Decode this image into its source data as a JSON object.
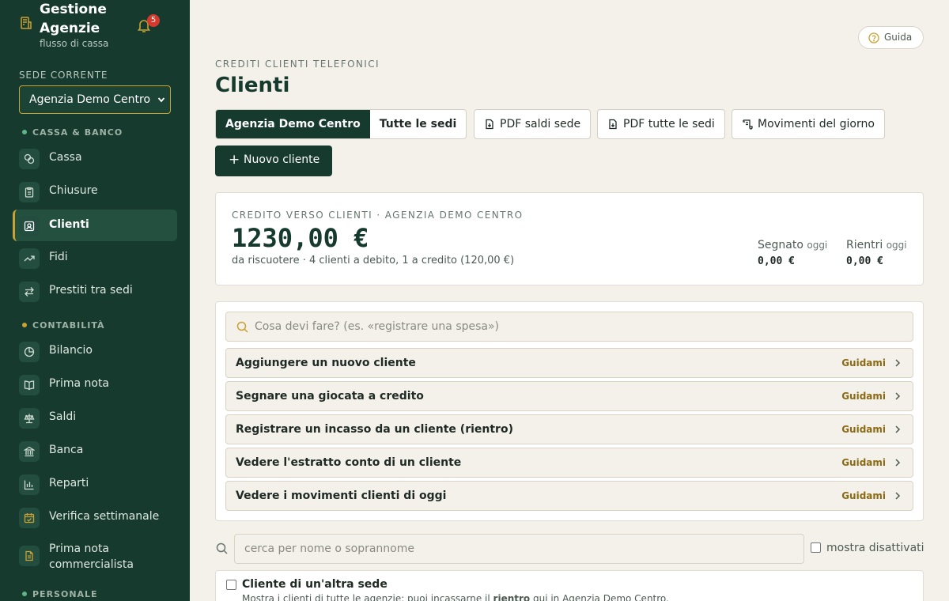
{
  "sidebar": {
    "brand_title": "Gestione Agenzie",
    "brand_subtitle": "flusso di cassa",
    "notification_count": "5",
    "sede_label": "SEDE CORRENTE",
    "sede_value": "Agenzia Demo Centro",
    "sections": [
      {
        "label": "CASSA & BANCO",
        "color": "#5fb58a"
      },
      {
        "label": "CONTABILITÀ",
        "color": "#c9a233"
      },
      {
        "label": "PERSONALE",
        "color": "#5fb58a"
      }
    ],
    "items": [
      {
        "label": "Cassa",
        "icon": "coins-icon"
      },
      {
        "label": "Chiusure",
        "icon": "clipboard-icon"
      },
      {
        "label": "Clienti",
        "icon": "contact-icon",
        "active": true
      },
      {
        "label": "Fidi",
        "icon": "trend-icon"
      },
      {
        "label": "Prestiti tra sedi",
        "icon": "swap-icon"
      },
      {
        "label": "Bilancio",
        "icon": "pie-chart-icon"
      },
      {
        "label": "Prima nota",
        "icon": "book-icon"
      },
      {
        "label": "Saldi",
        "icon": "scale-icon"
      },
      {
        "label": "Banca",
        "icon": "bank-icon"
      },
      {
        "label": "Reparti",
        "icon": "bar-chart-icon"
      },
      {
        "label": "Verifica settimanale",
        "icon": "calendar-check-icon"
      },
      {
        "label": "Prima nota commercialista",
        "icon": "document-icon"
      }
    ]
  },
  "header": {
    "guida_label": "Guida",
    "eyebrow": "CREDITI CLIENTI TELEFONICI",
    "title": "Clienti"
  },
  "toolbar": {
    "seg_current": "Agenzia Demo Centro",
    "seg_all": "Tutte le sedi",
    "pdf_sede": "PDF saldi sede",
    "pdf_all": "PDF tutte le sedi",
    "movements": "Movimenti del giorno",
    "new_client": "Nuovo cliente"
  },
  "credit": {
    "eyebrow": "CREDITO VERSO CLIENTI · AGENZIA DEMO CENTRO",
    "amount": "1230,00 €",
    "subtitle": "da riscuotere · 4 clienti a debito, 1 a credito (120,00 €)",
    "segnato_label": "Segnato",
    "segnato_suffix": "oggi",
    "segnato_value": "0,00 €",
    "rientri_label": "Rientri",
    "rientri_suffix": "oggi",
    "rientri_value": "0,00 €"
  },
  "guide": {
    "search_placeholder": "Cosa devi fare? (es. «registrare una spesa»)",
    "action_label": "Guidami",
    "items": [
      "Aggiungere un nuovo cliente",
      "Segnare una giocata a credito",
      "Registrare un incasso da un cliente (rientro)",
      "Vedere l'estratto conto di un cliente",
      "Vedere i movimenti clienti di oggi"
    ]
  },
  "filter": {
    "search_placeholder": "cerca per nome o soprannome",
    "show_disabled": "mostra disattivati"
  },
  "other_sede": {
    "title": "Cliente di un'altra sede",
    "desc_before": "Mostra i clienti di tutte le agenzie: puoi incassarne il ",
    "desc_bold": "rientro",
    "desc_after": " qui in Agenzia Demo Centro."
  },
  "colors": {
    "sidebar_bg": "#163a2e",
    "accent_gold": "#c9a233",
    "primary": "#163a2e",
    "guide_link": "#8a6a12",
    "badge": "#d63a2f"
  }
}
